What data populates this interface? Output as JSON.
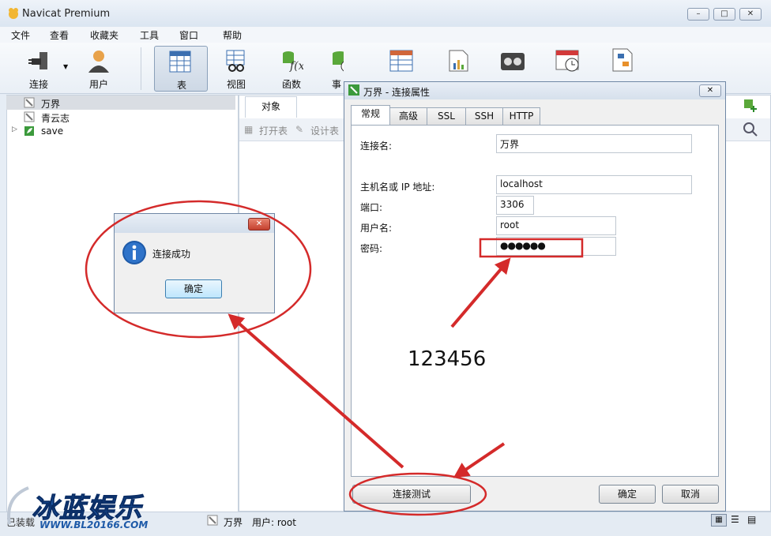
{
  "app": {
    "title": "Navicat Premium"
  },
  "window_controls": {
    "minimize": "–",
    "maximize": "□",
    "close": "✕"
  },
  "menu": [
    "文件",
    "查看",
    "收藏夹",
    "工具",
    "窗口",
    "帮助"
  ],
  "toolbar": {
    "items": [
      {
        "label": "连接",
        "icon": "plug-icon"
      },
      {
        "label": "用户",
        "icon": "user-icon"
      },
      {
        "label": "表",
        "icon": "table-icon",
        "active": true
      },
      {
        "label": "视图",
        "icon": "view-icon"
      },
      {
        "label": "函数",
        "icon": "function-icon"
      },
      {
        "label": "事",
        "icon": "event-icon"
      }
    ]
  },
  "tree": {
    "items": [
      {
        "label": "万界",
        "selected": true
      },
      {
        "label": "青云志"
      },
      {
        "label": "save"
      }
    ]
  },
  "object_pane": {
    "tab": "对象",
    "open_table": "打开表",
    "design_table": "设计表"
  },
  "status": {
    "left": "已装载",
    "connection": "万界",
    "user": "用户: root"
  },
  "conn_dialog": {
    "title": "万界 - 连接属性",
    "close": "✕",
    "tabs": [
      "常规",
      "高级",
      "SSL",
      "SSH",
      "HTTP"
    ],
    "fields": {
      "conn_name_label": "连接名:",
      "conn_name": "万界",
      "host_label": "主机名或 IP 地址:",
      "host": "localhost",
      "port_label": "端口:",
      "port": "3306",
      "user_label": "用户名:",
      "user": "root",
      "password_label": "密码:",
      "password": "●●●●●●"
    },
    "buttons": {
      "test": "连接测试",
      "ok": "确定",
      "cancel": "取消"
    }
  },
  "annotation": {
    "password_hint": "123456"
  },
  "msgbox": {
    "message": "连接成功",
    "ok": "确定",
    "close": "✕"
  },
  "watermark": {
    "brand": "冰蓝娱乐",
    "url": "WWW.BL20166.COM"
  },
  "colors": {
    "annotation_red": "#d42a2a",
    "selection": "#d9dde3",
    "accent_blue": "#1e5aa8"
  }
}
